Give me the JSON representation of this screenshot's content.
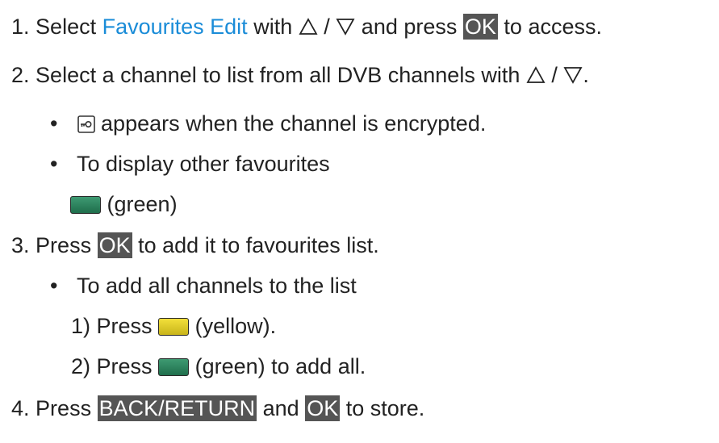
{
  "steps": {
    "s1": {
      "num": "1.",
      "pre": "Select",
      "link": "Favourites Edit",
      "mid": "with",
      "sep": "/",
      "post": "and press",
      "key": "OK",
      "end": "to access."
    },
    "s2": {
      "num": "2.",
      "text": "Select a channel to list from all DVB channels with",
      "sep": "/",
      "end": "."
    },
    "b1": {
      "text": "appears when the channel is encrypted."
    },
    "b2": {
      "text": "To display other favourites"
    },
    "b2sub": {
      "text": "(green)"
    },
    "s3": {
      "num": "3.",
      "pre": "Press",
      "key": "OK",
      "text": "to add it to favourites list."
    },
    "b3": {
      "text": "To add all channels to the list"
    },
    "sub1": {
      "num": "1)",
      "pre": "Press",
      "text": "(yellow)."
    },
    "sub2": {
      "num": "2)",
      "pre": "Press",
      "text": "(green) to add all."
    },
    "s4": {
      "num": "4.",
      "pre": "Press",
      "key1": "BACK/RETURN",
      "mid": "and",
      "key2": "OK",
      "end": "to store."
    }
  },
  "colors": {
    "link": "#1a8cd8",
    "key_bg": "#555555",
    "green_button": "#2e8660",
    "yellow_button": "#e0cc2a"
  },
  "icons": {
    "up": "up-triangle-icon",
    "down": "down-triangle-icon",
    "lock": "encrypted-key-icon"
  }
}
